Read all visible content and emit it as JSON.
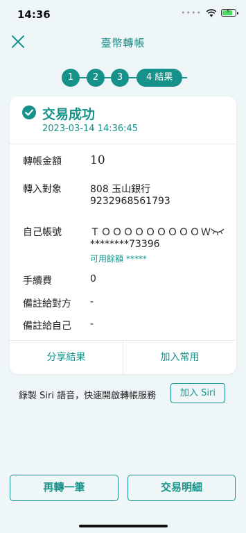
{
  "status_bar": {
    "time": "14:36",
    "signal": "••••"
  },
  "nav": {
    "title": "臺幣轉帳"
  },
  "steps": {
    "step1": "1",
    "step2": "2",
    "step3": "3",
    "current": "4 結果"
  },
  "result": {
    "title": "交易成功",
    "timestamp": "2023-03-14 14:36:45"
  },
  "details": {
    "amount_label": "轉帳金額",
    "amount_value": "10",
    "payee_label": "轉入對象",
    "payee_bank": "808 玉山銀行",
    "payee_account": "9232968561793",
    "own_account_label": "自己帳號",
    "own_account_name": "ＴＯＯＯＯＯＯＯＯＯＷ",
    "own_account_number": "********73396",
    "balance_text": "可用餘額 *****",
    "fee_label": "手續費",
    "fee_value": "0",
    "memo_payee_label": "備註給對方",
    "memo_payee_value": "-",
    "memo_self_label": "備註給自己",
    "memo_self_value": "-"
  },
  "card_actions": {
    "share": "分享結果",
    "favorite": "加入常用"
  },
  "siri": {
    "text": "錄製 Siri 語音，快速開啟轉帳服務",
    "button": "加入 Siri"
  },
  "bottom_actions": {
    "again": "再轉一筆",
    "details": "交易明細"
  },
  "colors": {
    "accent": "#17928a",
    "background": "#eef6f7"
  },
  "icons": {
    "close": "close-icon",
    "check": "check-circle-icon",
    "eye": "eye-closed-icon",
    "wifi": "wifi-icon",
    "battery": "battery-charging-icon"
  }
}
